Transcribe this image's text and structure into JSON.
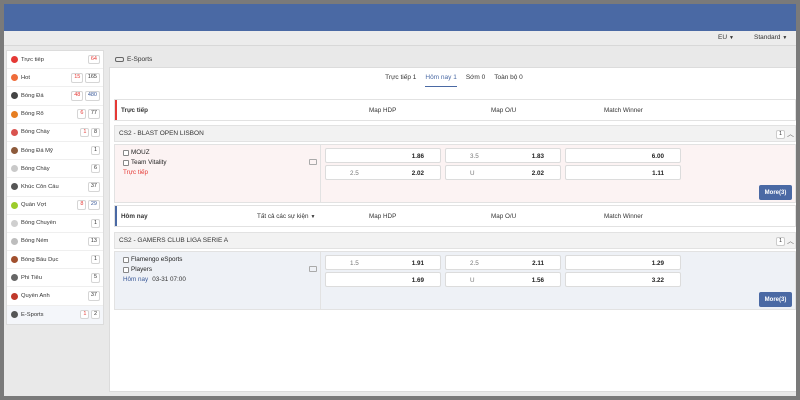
{
  "subbar": {
    "odds_format": "EU",
    "view_mode": "Standard"
  },
  "sidebar": {
    "items": [
      {
        "label": "Trực tiếp",
        "icon": "live-icon",
        "color": "#e53935",
        "counts": [
          "64"
        ],
        "styles": [
          "red"
        ]
      },
      {
        "label": "Hot",
        "icon": "fire-icon",
        "color": "#ef6c3a",
        "counts": [
          "15",
          "165"
        ],
        "styles": [
          "red",
          ""
        ]
      },
      {
        "label": "Bóng Đá",
        "icon": "soccer-ball-icon",
        "color": "#444444",
        "counts": [
          "48",
          "480"
        ],
        "styles": [
          "red",
          "blue"
        ]
      },
      {
        "label": "Bóng Rổ",
        "icon": "basketball-icon",
        "color": "#e67e22",
        "counts": [
          "6",
          "77"
        ],
        "styles": [
          "red",
          ""
        ]
      },
      {
        "label": "Bóng Chày",
        "icon": "baseball-icon",
        "color": "#d9534f",
        "counts": [
          "1",
          "8"
        ],
        "styles": [
          "red",
          ""
        ]
      },
      {
        "label": "Bóng Đá Mỹ",
        "icon": "american-football-icon",
        "color": "#8d5a3b",
        "counts": [
          "1"
        ],
        "styles": [
          ""
        ]
      },
      {
        "label": "Bóng Chày",
        "icon": "baseball-alt-icon",
        "color": "#c9c9c9",
        "counts": [
          "6"
        ],
        "styles": [
          ""
        ]
      },
      {
        "label": "Khúc Côn Cầu",
        "icon": "hockey-stick-icon",
        "color": "#555555",
        "counts": [
          "37"
        ],
        "styles": [
          ""
        ]
      },
      {
        "label": "Quần Vợt",
        "icon": "tennis-ball-icon",
        "color": "#9ccc2b",
        "counts": [
          "8",
          "29"
        ],
        "styles": [
          "red",
          "blue"
        ]
      },
      {
        "label": "Bóng Chuyền",
        "icon": "volleyball-icon",
        "color": "#cfcfcf",
        "counts": [
          "1"
        ],
        "styles": [
          ""
        ]
      },
      {
        "label": "Bóng Ném",
        "icon": "handball-icon",
        "color": "#bdbdbd",
        "counts": [
          "13"
        ],
        "styles": [
          ""
        ]
      },
      {
        "label": "Bóng Bầu Dục",
        "icon": "rugby-ball-icon",
        "color": "#a1502e",
        "counts": [
          "1"
        ],
        "styles": [
          ""
        ]
      },
      {
        "label": "Phi Tiêu",
        "icon": "darts-icon",
        "color": "#666666",
        "counts": [
          "5"
        ],
        "styles": [
          ""
        ]
      },
      {
        "label": "Quyền Anh",
        "icon": "boxing-glove-icon",
        "color": "#c0392b",
        "counts": [
          "37"
        ],
        "styles": [
          ""
        ]
      },
      {
        "label": "E-Sports",
        "icon": "gamepad-icon",
        "color": "#555555",
        "counts": [
          "1",
          "2"
        ],
        "styles": [
          "red",
          ""
        ]
      }
    ]
  },
  "main": {
    "heading": "E-Sports",
    "tabs": [
      "Trực tiếp 1",
      "Hôm nay 1",
      "Sớm 0",
      "Toàn bộ 0"
    ],
    "active_tab": 1,
    "live_section": {
      "title": "Trực tiếp",
      "col_hdp": "Map HDP",
      "col_ou": "Map O/U",
      "col_winner": "Match Winner",
      "accent": "#e53935",
      "league": {
        "name": "CS2 - BLAST OPEN LISBON",
        "count": "1"
      },
      "match": {
        "home": "MOUZ",
        "away": "Team Vitality",
        "status": "Trực tiếp",
        "hdp": [
          {
            "line": "",
            "odds": "1.86"
          },
          {
            "line": "2.5",
            "odds": "2.02"
          }
        ],
        "ou": [
          {
            "line": "3.5",
            "odds": "1.83"
          },
          {
            "line": "U",
            "odds": "2.02"
          }
        ],
        "winner": [
          "6.00",
          "1.11"
        ],
        "more": "More(3)"
      }
    },
    "today_section": {
      "title": "Hôm nay",
      "filter": "Tất cả các sự kiện",
      "col_hdp": "Map HDP",
      "col_ou": "Map O/U",
      "col_winner": "Match Winner",
      "accent": "#4a69a4",
      "league": {
        "name": "CS2 - GAMERS CLUB LIGA SERIE A",
        "count": "1"
      },
      "match": {
        "home": "Flamengo eSports",
        "away": "Players",
        "status": "Hôm nay",
        "time": "03-31 07:00",
        "hdp": [
          {
            "line": "1.5",
            "odds": "1.91"
          },
          {
            "line": "",
            "odds": "1.69"
          }
        ],
        "ou": [
          {
            "line": "2.5",
            "odds": "2.11"
          },
          {
            "line": "U",
            "odds": "1.56"
          }
        ],
        "winner": [
          "1.29",
          "3.22"
        ],
        "more": "More(3)"
      }
    }
  }
}
